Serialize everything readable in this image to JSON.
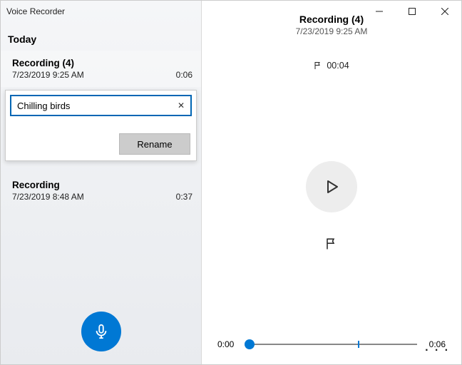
{
  "app": {
    "title": "Voice Recorder"
  },
  "window": {
    "minimize": "—",
    "maximize": "▢",
    "close": "✕"
  },
  "sidebar": {
    "section_label": "Today",
    "items": [
      {
        "title": "Recording (4)",
        "timestamp": "7/23/2019 9:25 AM",
        "duration": "0:06",
        "selected": true
      },
      {
        "title": "Recording",
        "timestamp": "7/23/2019 8:48 AM",
        "duration": "0:37",
        "selected": false
      }
    ]
  },
  "rename": {
    "value": "Chilling birds",
    "clear_icon": "✕",
    "button_label": "Rename"
  },
  "player": {
    "title": "Recording (4)",
    "timestamp": "7/23/2019 9:25 AM",
    "marker_time": "00:04",
    "timeline": {
      "current": "0:00",
      "total": "0:06",
      "thumb_percent": 2,
      "marker_percent": 66
    },
    "more": "· · ·"
  },
  "icons": {
    "mic": "mic",
    "flag": "flag",
    "play": "play"
  },
  "colors": {
    "accent": "#0078d4"
  }
}
